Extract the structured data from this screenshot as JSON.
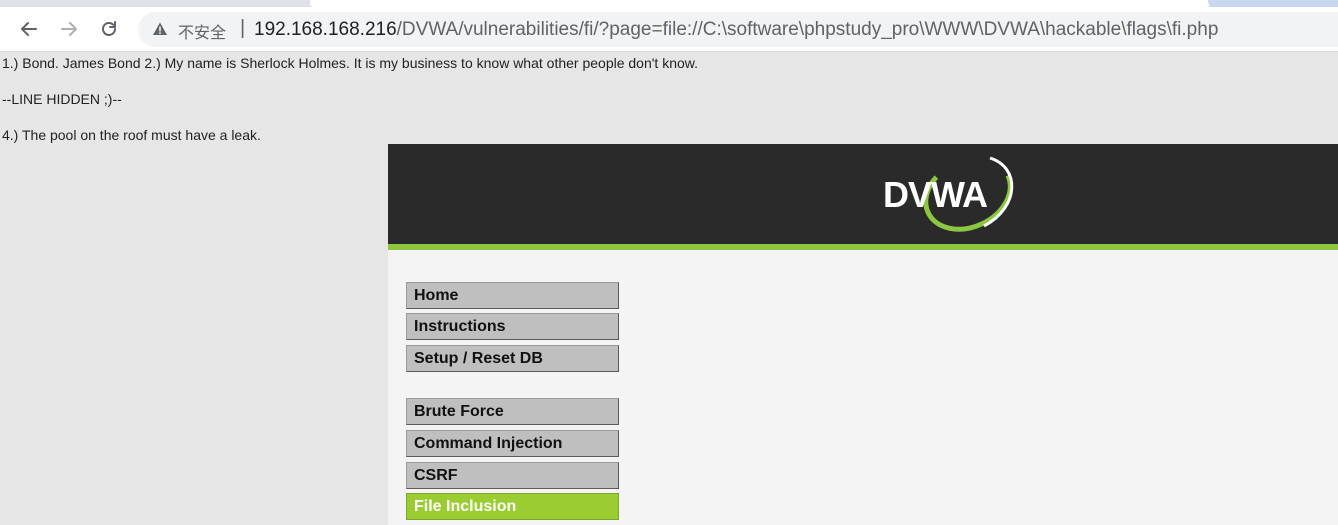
{
  "browser": {
    "security_label": "不安全",
    "separator": "|",
    "url_host": "192.168.168.216",
    "url_path": "/DVWA/vulnerabilities/fi/?page=file://C:\\software\\phpstudy_pro\\WWW\\DVWA\\hackable\\flags\\fi.php",
    "icons": {
      "back": "back-arrow-icon",
      "forward": "forward-arrow-icon",
      "reload": "reload-icon",
      "warning": "warning-icon"
    }
  },
  "included_file": {
    "line1": "1.) Bond. James Bond 2.) My name is Sherlock Holmes. It is my business to know what other people don't know.",
    "line2": "--LINE HIDDEN ;)--",
    "line3": "4.) The pool on the roof must have a leak."
  },
  "header": {
    "logo_text": "DVWA",
    "colors": {
      "header_bg": "#2a2a2a",
      "accent": "#8dc63f"
    }
  },
  "menu": {
    "items": [
      {
        "label": "Home"
      },
      {
        "label": "Instructions"
      },
      {
        "label": "Setup / Reset DB"
      },
      {
        "label": "Brute Force"
      },
      {
        "label": "Command Injection"
      },
      {
        "label": "CSRF"
      },
      {
        "label": "File Inclusion",
        "selected": true
      }
    ],
    "selected_color": "#9acd32"
  }
}
